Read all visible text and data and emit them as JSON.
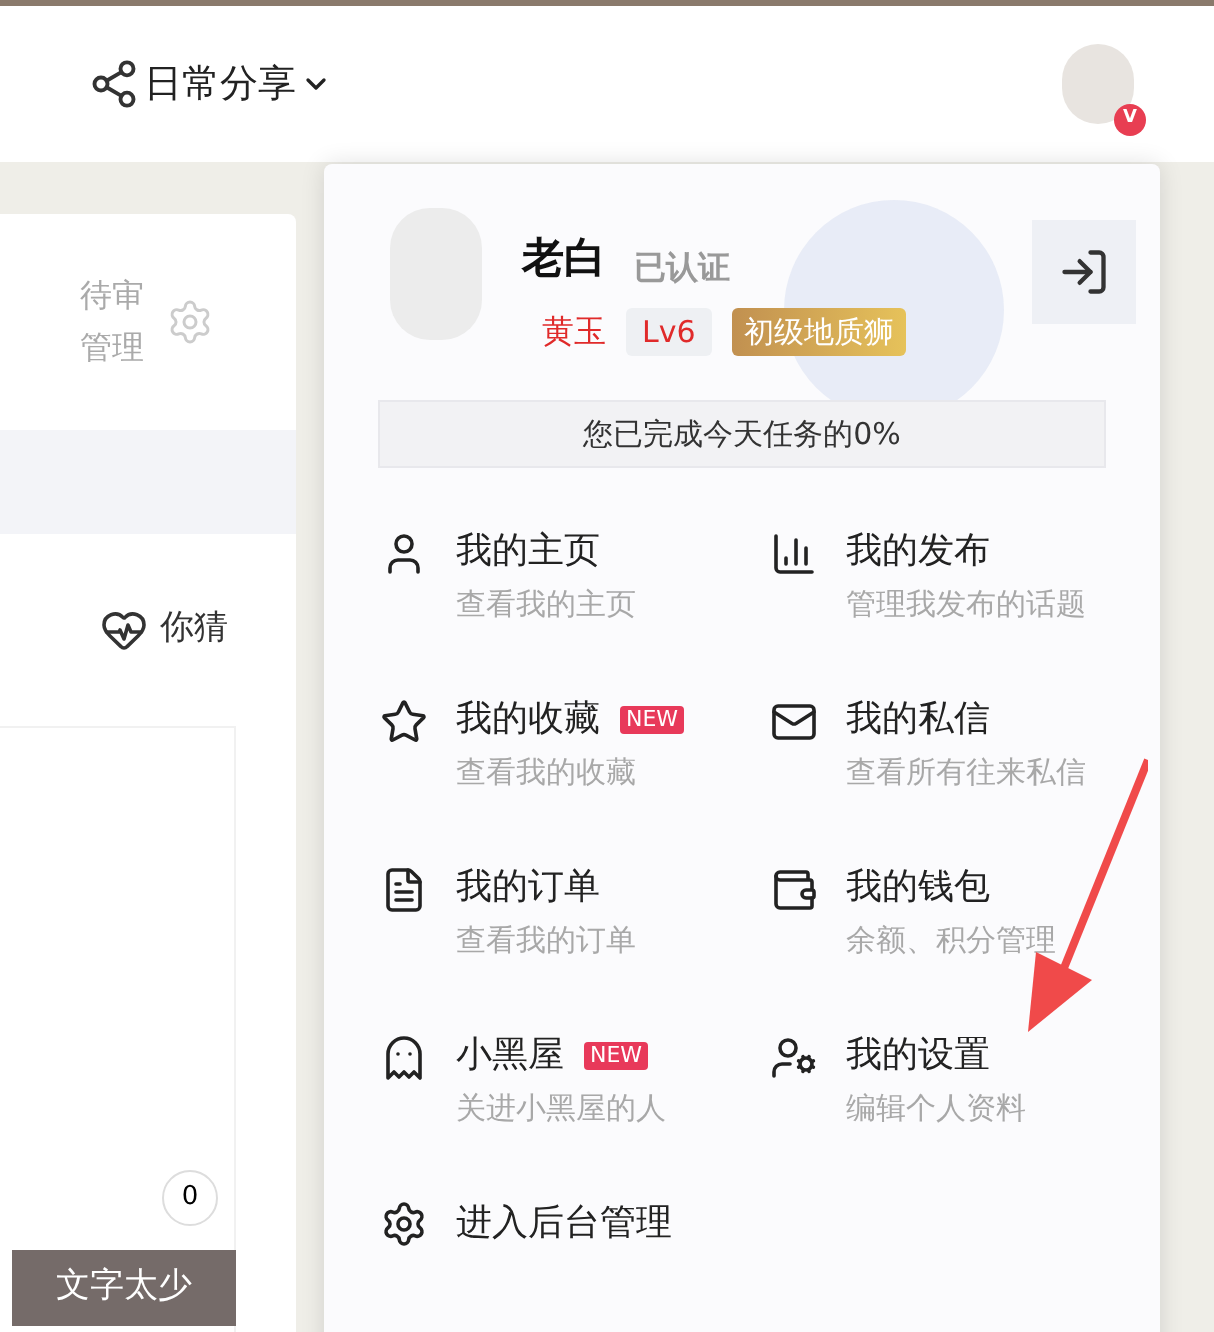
{
  "nav": {
    "items": [
      {
        "label": "日常分享"
      }
    ],
    "avatar_badge": "V"
  },
  "left_card": {
    "review_label": "待审管理",
    "tabs": [
      {
        "label": "你猜"
      }
    ],
    "count": "0",
    "button": "文字太少"
  },
  "dropdown": {
    "name": "老白",
    "verified": "已认证",
    "gem": "黄玉",
    "level": "Lv6",
    "rank": "初级地质狮",
    "progress_text": "您已完成今天任务的0%",
    "progress": {
      "level": 0
    },
    "menu": [
      {
        "title": "我的主页",
        "subtitle": "查看我的主页"
      },
      {
        "title": "我的发布",
        "subtitle": "管理我发布的话题"
      },
      {
        "title": "我的收藏",
        "subtitle": "查看我的收藏",
        "badge": "NEW"
      },
      {
        "title": "我的私信",
        "subtitle": "查看所有往来私信"
      },
      {
        "title": "我的订单",
        "subtitle": "查看我的订单"
      },
      {
        "title": "我的钱包",
        "subtitle": "余额、积分管理"
      },
      {
        "title": "小黑屋",
        "subtitle": "关进小黑屋的人",
        "badge": "NEW"
      },
      {
        "title": "我的设置",
        "subtitle": "编辑个人资料"
      }
    ],
    "admin": "进入后台管理"
  }
}
